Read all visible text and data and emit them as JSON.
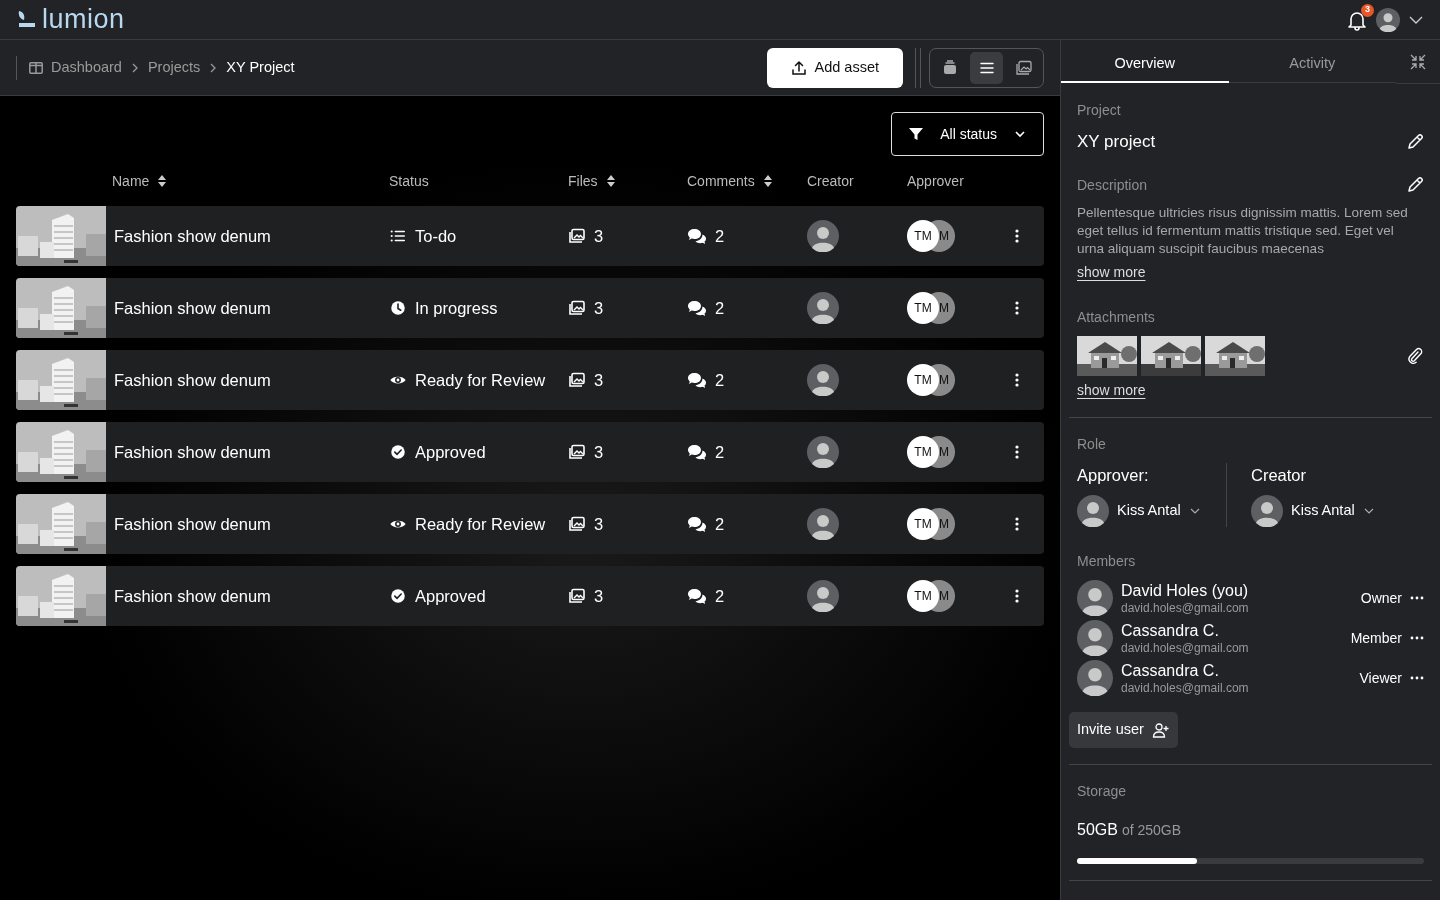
{
  "header": {
    "logo": "lumion",
    "notifications": "3"
  },
  "breadcrumb": [
    {
      "label": "Dashboard",
      "current": false
    },
    {
      "label": "Projects",
      "current": false
    },
    {
      "label": "XY Project",
      "current": true
    }
  ],
  "toolbar": {
    "add_button": "Add asset",
    "view_modes": [
      {
        "kind": "stack",
        "selected": false
      },
      {
        "kind": "list",
        "selected": true
      },
      {
        "kind": "gallery",
        "selected": false
      }
    ]
  },
  "filter": {
    "label": "All status"
  },
  "table": {
    "columns": [
      {
        "label": "Name",
        "sortable": true
      },
      {
        "label": "Status",
        "sortable": false
      },
      {
        "label": "Files",
        "sortable": true
      },
      {
        "label": "Comments",
        "sortable": true
      },
      {
        "label": "Creator",
        "sortable": false
      },
      {
        "label": "Approver",
        "sortable": false
      }
    ],
    "rows": [
      {
        "name": "Fashion show denum",
        "status": "To-do",
        "kind": "todo",
        "files": "3",
        "comments": "2",
        "approvers": [
          "TM",
          "M"
        ]
      },
      {
        "name": "Fashion show denum",
        "status": "In progress",
        "kind": "progress",
        "files": "3",
        "comments": "2",
        "approvers": [
          "TM",
          "M"
        ]
      },
      {
        "name": "Fashion show denum",
        "status": "Ready for Review",
        "kind": "review",
        "files": "3",
        "comments": "2",
        "approvers": [
          "TM",
          "M"
        ]
      },
      {
        "name": "Fashion show denum",
        "status": "Approved",
        "kind": "approved",
        "files": "3",
        "comments": "2",
        "approvers": [
          "TM",
          "M"
        ]
      },
      {
        "name": "Fashion show denum",
        "status": "Ready for Review",
        "kind": "review",
        "files": "3",
        "comments": "2",
        "approvers": [
          "TM",
          "M"
        ]
      },
      {
        "name": "Fashion show denum",
        "status": "Approved",
        "kind": "approved",
        "files": "3",
        "comments": "2",
        "approvers": [
          "TM",
          "M"
        ]
      }
    ]
  },
  "panel": {
    "tabs": [
      {
        "label": "Overview",
        "selected": true
      },
      {
        "label": "Activity",
        "selected": false
      }
    ],
    "project_label": "Project",
    "project_name": "XY project",
    "description_label": "Description",
    "description": "Pellentesque ultricies risus dignissim mattis. Lorem sed eget tellus id fermentum mattis tristique sed. Eget vel urna aliquam suscipit faucibus maecenas",
    "description_more": "show more",
    "attachments_label": "Attachments",
    "attachments": [
      {
        "kind": "picture"
      },
      {
        "kind": "picture"
      },
      {
        "kind": "picture"
      }
    ],
    "attachments_more": "show more",
    "role_label": "Role",
    "roles": [
      {
        "title": "Approver:",
        "person": "Kiss Antal"
      },
      {
        "title": "Creator",
        "person": "Kiss Antal"
      }
    ],
    "members_label": "Members",
    "members": [
      {
        "name": "David Holes (you)",
        "email": "david.holes@gmail.com",
        "role": "Owner"
      },
      {
        "name": "Cassandra C.",
        "email": "david.holes@gmail.com",
        "role": "Member"
      },
      {
        "name": "Cassandra C.",
        "email": "david.holes@gmail.com",
        "role": "Viewer"
      }
    ],
    "invite_button": "Invite user",
    "storage_label": "Storage",
    "storage_used": "50GB",
    "storage_total": "of 250GB",
    "level": 0.345
  }
}
